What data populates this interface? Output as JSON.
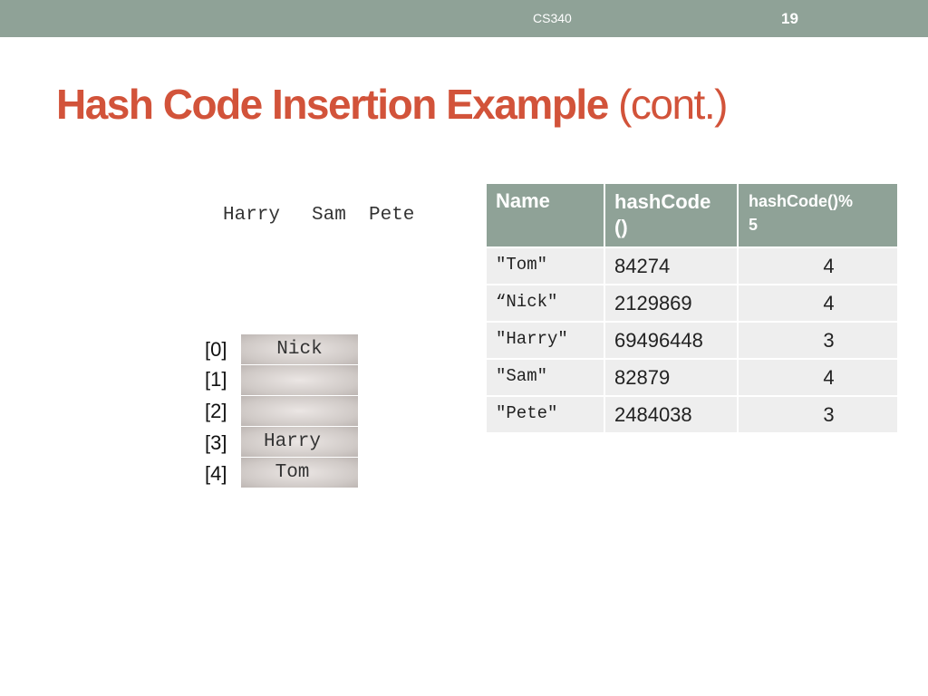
{
  "header": {
    "course": "CS340",
    "page_number": "19"
  },
  "title": {
    "main": "Hash Code Insertion Example",
    "suffix": "(cont.)"
  },
  "pending_words": [
    "Harry",
    "Sam",
    "Pete"
  ],
  "hash_table": {
    "indices": [
      "[0]",
      "[1]",
      "[2]",
      "[3]",
      "[4]"
    ],
    "cells": [
      "Nick",
      "",
      "",
      "Harry",
      "Tom"
    ]
  },
  "table": {
    "headers": [
      "Name",
      "hashCode\n()",
      "hashCode()%\n5"
    ],
    "rows": [
      {
        "name": "\"Tom\"",
        "hash": "84274",
        "mod": "4"
      },
      {
        "name": "“Nick\"",
        "hash": "2129869",
        "mod": "4"
      },
      {
        "name": "\"Harry\"",
        "hash": "69496448",
        "mod": "3"
      },
      {
        "name": "\"Sam\"",
        "hash": "82879",
        "mod": "4"
      },
      {
        "name": "\"Pete\"",
        "hash": "2484038",
        "mod": "3"
      }
    ]
  },
  "colors": {
    "accent": "#d2533a",
    "bar": "#8fa297",
    "table_cell": "#eeeeee"
  }
}
